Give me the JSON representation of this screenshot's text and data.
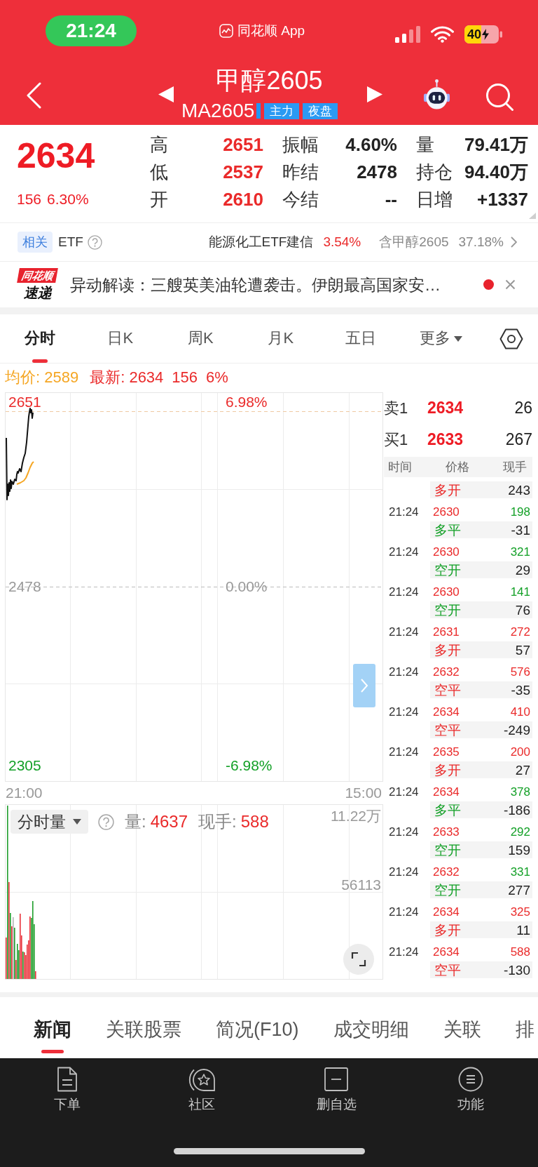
{
  "status_bar": {
    "time": "21:24",
    "app_label": "同花顺 App",
    "battery": "40"
  },
  "header": {
    "title": "甲醇2605",
    "code": "MA2605",
    "tags": [
      "主力",
      "夜盘"
    ]
  },
  "quote": {
    "price": "2634",
    "change": "156",
    "change_percent": "6.30%",
    "stats": [
      {
        "label": "高",
        "value": "2651",
        "up": true
      },
      {
        "label": "振幅",
        "value": "4.60%",
        "up": false
      },
      {
        "label": "量",
        "value": "79.41万",
        "up": false
      },
      {
        "label": "低",
        "value": "2537",
        "up": true
      },
      {
        "label": "昨结",
        "value": "2478",
        "up": false
      },
      {
        "label": "持仓",
        "value": "94.40万",
        "up": false
      },
      {
        "label": "开",
        "value": "2610",
        "up": true
      },
      {
        "label": "今结",
        "value": "--",
        "up": false
      },
      {
        "label": "日增",
        "value": "+1337",
        "up": false
      }
    ]
  },
  "related_etf": {
    "badge": "相关",
    "label": "ETF",
    "fund": "能源化工ETF建信",
    "fund_change": "3.54%",
    "holding": "含甲醇2605",
    "holding_weight": "37.18%"
  },
  "news_alert": {
    "logo_top": "同花顺",
    "logo_bottom": "速递",
    "text": "异动解读：三艘英美油轮遭袭击。伊朗最高国家安…",
    "unread": true
  },
  "chart_tabs": [
    {
      "label": "分时",
      "selected": true,
      "kind": "tab"
    },
    {
      "label": "日K",
      "selected": false,
      "kind": "tab"
    },
    {
      "label": "周K",
      "selected": false,
      "kind": "tab"
    },
    {
      "label": "月K",
      "selected": false,
      "kind": "tab"
    },
    {
      "label": "五日",
      "selected": false,
      "kind": "tab"
    },
    {
      "label": "更多",
      "selected": false,
      "kind": "menu"
    }
  ],
  "chart_info": [
    {
      "text": "均价: 2589",
      "kind": "average"
    },
    {
      "text": "最新: 2634",
      "kind": "latest"
    },
    {
      "text": "156",
      "kind": "latest"
    },
    {
      "text": "6%",
      "kind": "latest"
    }
  ],
  "price_chart": {
    "left_labels": [
      "2651",
      "2478",
      "2305"
    ],
    "right_labels": [
      "6.98%",
      "0.00%",
      "-6.98%"
    ],
    "time_labels": [
      "21:00",
      "15:00"
    ]
  },
  "volume_chart": {
    "selector": "分时量",
    "stats": [
      {
        "label": "量:",
        "value": "4637"
      },
      {
        "label": "现手:",
        "value": "588"
      }
    ],
    "axis_labels": [
      "11.22万",
      "56113"
    ]
  },
  "order_book": [
    {
      "label": "卖1",
      "price": "2634",
      "volume": "26"
    },
    {
      "label": "买1",
      "price": "2633",
      "volume": "267"
    }
  ],
  "trades": {
    "columns": [
      "时间",
      "价格",
      "现手"
    ],
    "rows": [
      {
        "action": "多开",
        "position_change": "243",
        "color": "#ea2a2a"
      },
      {
        "time": "21:24",
        "price": "2630",
        "volume": "198",
        "action": "多平",
        "position_change": "-31",
        "color": "#13a027"
      },
      {
        "time": "21:24",
        "price": "2630",
        "volume": "321",
        "action": "空开",
        "position_change": "29",
        "color": "#13a027"
      },
      {
        "time": "21:24",
        "price": "2630",
        "volume": "141",
        "action": "空开",
        "position_change": "76",
        "color": "#13a027"
      },
      {
        "time": "21:24",
        "price": "2631",
        "volume": "272",
        "action": "多开",
        "position_change": "57",
        "color": "#ea2a2a"
      },
      {
        "time": "21:24",
        "price": "2632",
        "volume": "576",
        "action": "空平",
        "position_change": "-35",
        "color": "#ea2a2a"
      },
      {
        "time": "21:24",
        "price": "2634",
        "volume": "410",
        "action": "空平",
        "position_change": "-249",
        "color": "#ea2a2a"
      },
      {
        "time": "21:24",
        "price": "2635",
        "volume": "200",
        "action": "多开",
        "position_change": "27",
        "color": "#ea2a2a"
      },
      {
        "time": "21:24",
        "price": "2634",
        "volume": "378",
        "action": "多平",
        "position_change": "-186",
        "color": "#13a027"
      },
      {
        "time": "21:24",
        "price": "2633",
        "volume": "292",
        "action": "空开",
        "position_change": "159",
        "color": "#13a027"
      },
      {
        "time": "21:24",
        "price": "2632",
        "volume": "331",
        "action": "空开",
        "position_change": "277",
        "color": "#13a027"
      },
      {
        "time": "21:24",
        "price": "2634",
        "volume": "325",
        "action": "多开",
        "position_change": "11",
        "color": "#ea2a2a"
      },
      {
        "time": "21:24",
        "price": "2634",
        "volume": "588",
        "action": "空平",
        "position_change": "-130",
        "color": "#ea2a2a"
      }
    ]
  },
  "bottom_tabs": [
    {
      "label": "新闻",
      "selected": true
    },
    {
      "label": "关联股票",
      "selected": false
    },
    {
      "label": "简况(F10)",
      "selected": false
    },
    {
      "label": "成交明细",
      "selected": false
    },
    {
      "label": "关联",
      "selected": false
    },
    {
      "label": "排",
      "selected": false
    }
  ],
  "bottom_nav": [
    {
      "label": "下单"
    },
    {
      "label": "社区"
    },
    {
      "label": "删自选"
    },
    {
      "label": "功能"
    }
  ]
}
